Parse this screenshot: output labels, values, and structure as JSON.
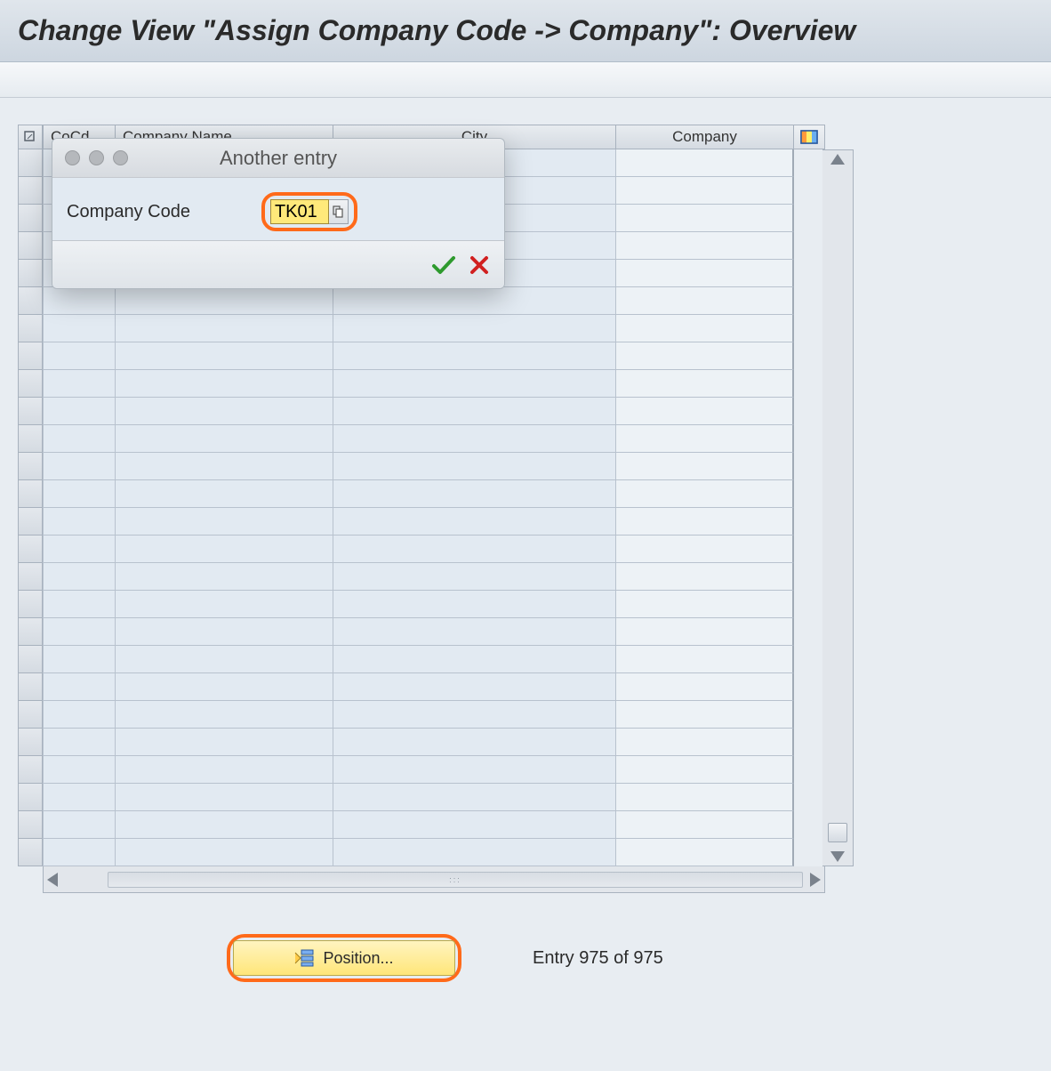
{
  "title": "Change View \"Assign Company Code -> Company\": Overview",
  "table": {
    "columns": {
      "cocd": "CoCd",
      "name": "Company Name",
      "city": "City",
      "company": "Company"
    },
    "row_count": 26
  },
  "dialog": {
    "title": "Another entry",
    "label": "Company Code",
    "value": "TK01"
  },
  "footer": {
    "position_label": "Position...",
    "entry_text": "Entry 975 of 975"
  }
}
